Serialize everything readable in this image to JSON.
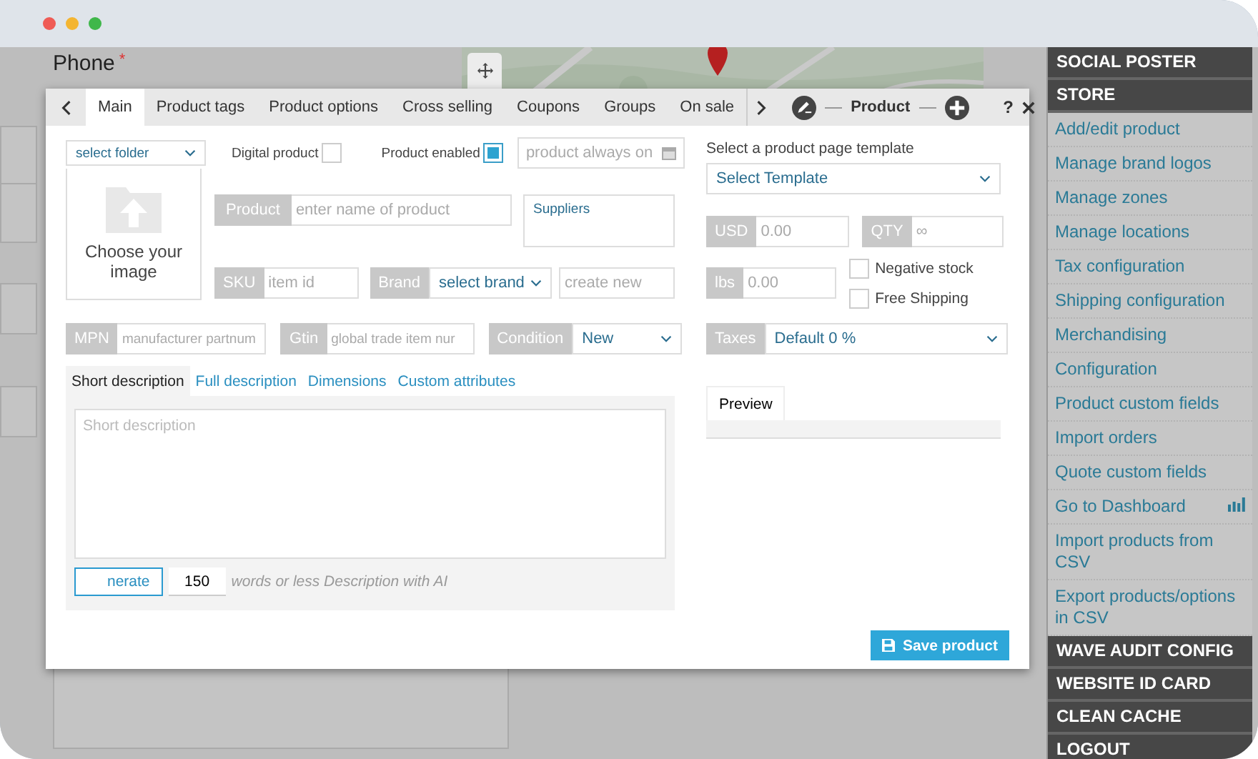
{
  "background": {
    "field_label": "Phone",
    "required_mark": "*"
  },
  "modal": {
    "tabs": [
      {
        "label": "Main",
        "selected": true
      },
      {
        "label": "Product tags",
        "selected": false
      },
      {
        "label": "Product options",
        "selected": false
      },
      {
        "label": "Cross selling",
        "selected": false
      },
      {
        "label": "Coupons",
        "selected": false
      },
      {
        "label": "Groups",
        "selected": false
      },
      {
        "label": "On sale",
        "selected": false
      }
    ],
    "title": "Product",
    "help": "?",
    "folder_select": "select folder",
    "image_upload": "Choose your image",
    "digital_product": {
      "label": "Digital product",
      "checked": false
    },
    "product_enabled": {
      "label": "Product enabled",
      "checked": true
    },
    "availability": {
      "placeholder": "product always on"
    },
    "product": {
      "label": "Product",
      "placeholder": "enter name of product"
    },
    "suppliers": "Suppliers",
    "sku": {
      "label": "SKU",
      "placeholder": "item id"
    },
    "brand": {
      "label": "Brand",
      "value": "select brand"
    },
    "brand_new": {
      "placeholder": "create new"
    },
    "mpn": {
      "label": "MPN",
      "placeholder": "manufacturer partnum"
    },
    "gtin": {
      "label": "Gtin",
      "placeholder": "global trade item nur"
    },
    "condition": {
      "label": "Condition",
      "value": "New"
    },
    "description_tabs": [
      {
        "label": "Short description",
        "selected": true
      },
      {
        "label": "Full description",
        "selected": false
      },
      {
        "label": "Dimensions",
        "selected": false
      },
      {
        "label": "Custom attributes",
        "selected": false
      }
    ],
    "description": {
      "placeholder": "Short description"
    },
    "generate_button": "nerate",
    "word_limit": "150",
    "word_limit_note": "words or less Description with AI",
    "template": {
      "label": "Select a product page template",
      "value": "Select Template"
    },
    "price": {
      "label": "USD",
      "placeholder": "0.00"
    },
    "qty": {
      "label": "QTY",
      "placeholder": "∞"
    },
    "weight": {
      "label": "lbs",
      "placeholder": "0.00"
    },
    "options": [
      {
        "label": "Negative stock",
        "checked": false
      },
      {
        "label": "Free Shipping",
        "checked": false
      }
    ],
    "taxes": {
      "label": "Taxes",
      "value": "Default 0 %"
    },
    "preview_tab": "Preview",
    "save_button": "Save product"
  },
  "sidebar": {
    "sections": [
      {
        "title": "SOCIAL POSTER"
      },
      {
        "title": "STORE",
        "items": [
          {
            "label": "Add/edit product",
            "kind": "link"
          },
          {
            "label": "Manage brand logos",
            "kind": "link"
          },
          {
            "label": "Manage zones",
            "kind": "link"
          },
          {
            "label": "Manage locations",
            "kind": "link"
          },
          {
            "label": "Tax configuration",
            "kind": "link"
          },
          {
            "label": "Shipping configuration",
            "kind": "link"
          },
          {
            "label": "Merchandising",
            "kind": "link"
          },
          {
            "label": "Configuration",
            "kind": "link"
          },
          {
            "label": "Product custom fields",
            "kind": "link"
          },
          {
            "label": "Import orders",
            "kind": "link"
          },
          {
            "label": "Quote custom fields",
            "kind": "link"
          },
          {
            "label": "Go to Dashboard",
            "kind": "chart-link"
          },
          {
            "label": "Import products from CSV",
            "kind": "link"
          },
          {
            "label": "Export products/options in CSV",
            "kind": "link"
          }
        ]
      },
      {
        "title": "WAVE AUDIT CONFIG"
      },
      {
        "title": "WEBSITE ID CARD"
      },
      {
        "title": "CLEAN CACHE"
      },
      {
        "title": "LOGOUT"
      }
    ]
  }
}
